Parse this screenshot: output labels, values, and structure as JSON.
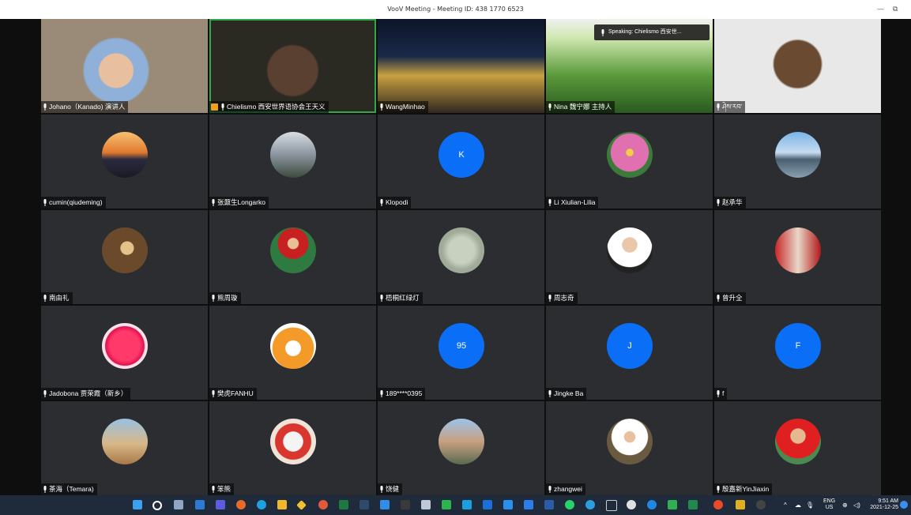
{
  "window": {
    "title": "VooV Meeting - Meeting ID: 438 1770 6523",
    "minimize_glyph": "—",
    "restore_glyph": "⧉"
  },
  "speaking_banner": "Speaking: Chielismo 西安世...",
  "participants": [
    {
      "name": "Johano（Kanado) 演讲人",
      "kind": "video"
    },
    {
      "name": "Chielismo 西安世界语协会王天义",
      "kind": "video",
      "active": true,
      "badge": true
    },
    {
      "name": "WangMinhao",
      "kind": "video"
    },
    {
      "name": "Nina 魏宁娜 主持人",
      "kind": "video"
    },
    {
      "name": "ཤེས་རབ་",
      "kind": "video"
    },
    {
      "name": "cumin(qiudeming)",
      "kind": "photo",
      "photo": "sunset"
    },
    {
      "name": "张鼐生Longarko",
      "kind": "photo",
      "photo": "mountain"
    },
    {
      "name": "Klopodi",
      "kind": "letter",
      "letter": "K"
    },
    {
      "name": "Li Xiulian-Lilia",
      "kind": "photo",
      "photo": "flower-pink"
    },
    {
      "name": "赵承华",
      "kind": "photo",
      "photo": "lake"
    },
    {
      "name": "南由礼",
      "kind": "photo",
      "photo": "person-brown"
    },
    {
      "name": "熊周璇",
      "kind": "photo",
      "photo": "costume"
    },
    {
      "name": "梧桐红绿灯",
      "kind": "photo",
      "photo": "sketch"
    },
    {
      "name": "周志奇",
      "kind": "photo",
      "photo": "portrait"
    },
    {
      "name": "曾升全",
      "kind": "photo",
      "photo": "lanterns"
    },
    {
      "name": "Jadobona 贾荣霞（新乡）",
      "kind": "photo",
      "photo": "rose"
    },
    {
      "name": "樊虎FANHU",
      "kind": "photo",
      "photo": "tiger"
    },
    {
      "name": "189****0395",
      "kind": "letter",
      "letter": "95"
    },
    {
      "name": "Jingke Ba",
      "kind": "letter",
      "letter": "J"
    },
    {
      "name": "f",
      "kind": "letter",
      "letter": "F"
    },
    {
      "name": "茶海（Temara)",
      "kind": "photo",
      "photo": "desert"
    },
    {
      "name": "笨熊",
      "kind": "photo",
      "photo": "dog"
    },
    {
      "name": "饶健",
      "kind": "photo",
      "photo": "city"
    },
    {
      "name": "zhangwei",
      "kind": "photo",
      "photo": "table"
    },
    {
      "name": "殷嘉新YinJiaxin",
      "kind": "photo",
      "photo": "red-shirt"
    }
  ],
  "taskbar": {
    "tray_lang": "ENG",
    "tray_region": "US",
    "time": "9:51 AM",
    "date": "2021-12-25"
  }
}
